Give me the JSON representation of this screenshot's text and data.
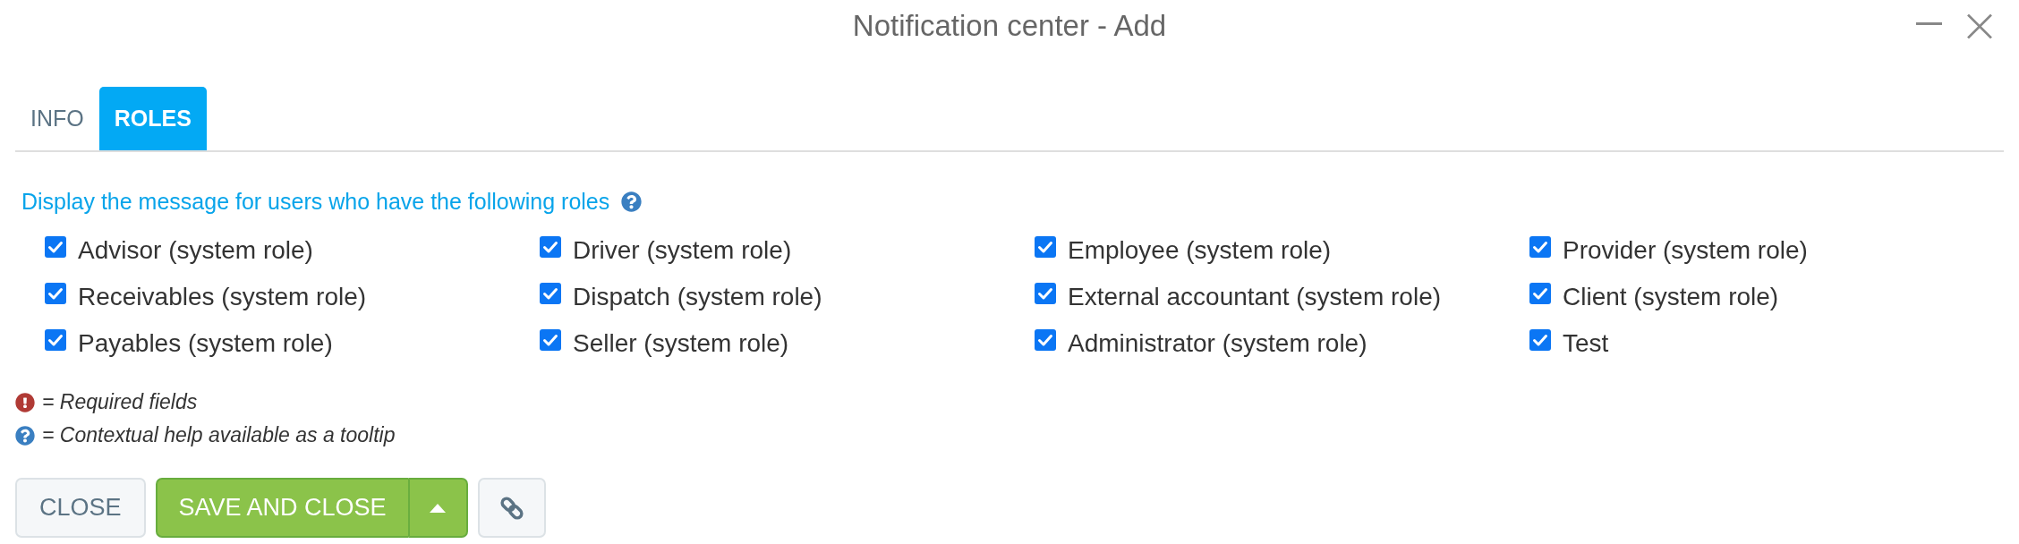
{
  "window": {
    "title": "Notification center - Add"
  },
  "tabs": [
    {
      "label": "INFO",
      "selected": false
    },
    {
      "label": "ROLES",
      "selected": true
    }
  ],
  "roles": {
    "heading": "Display the message for users who have the following roles",
    "items": [
      {
        "label": "Advisor (system role)",
        "checked": true
      },
      {
        "label": "Driver (system role)",
        "checked": true
      },
      {
        "label": "Employee (system role)",
        "checked": true
      },
      {
        "label": "Provider (system role)",
        "checked": true
      },
      {
        "label": "Receivables (system role)",
        "checked": true
      },
      {
        "label": "Dispatch (system role)",
        "checked": true
      },
      {
        "label": "External accountant (system role)",
        "checked": true
      },
      {
        "label": "Client (system role)",
        "checked": true
      },
      {
        "label": "Payables (system role)",
        "checked": true
      },
      {
        "label": "Seller (system role)",
        "checked": true
      },
      {
        "label": "Administrator (system role)",
        "checked": true
      },
      {
        "label": "Test",
        "checked": true
      }
    ]
  },
  "legend": [
    {
      "kind": "required",
      "text": "= Required fields"
    },
    {
      "kind": "help",
      "text": "= Contextual help available as a tooltip"
    }
  ],
  "buttons": [
    {
      "kind": "secondary",
      "label": "CLOSE"
    },
    {
      "kind": "split",
      "label": "SAVE AND CLOSE"
    },
    {
      "kind": "icon"
    }
  ]
}
